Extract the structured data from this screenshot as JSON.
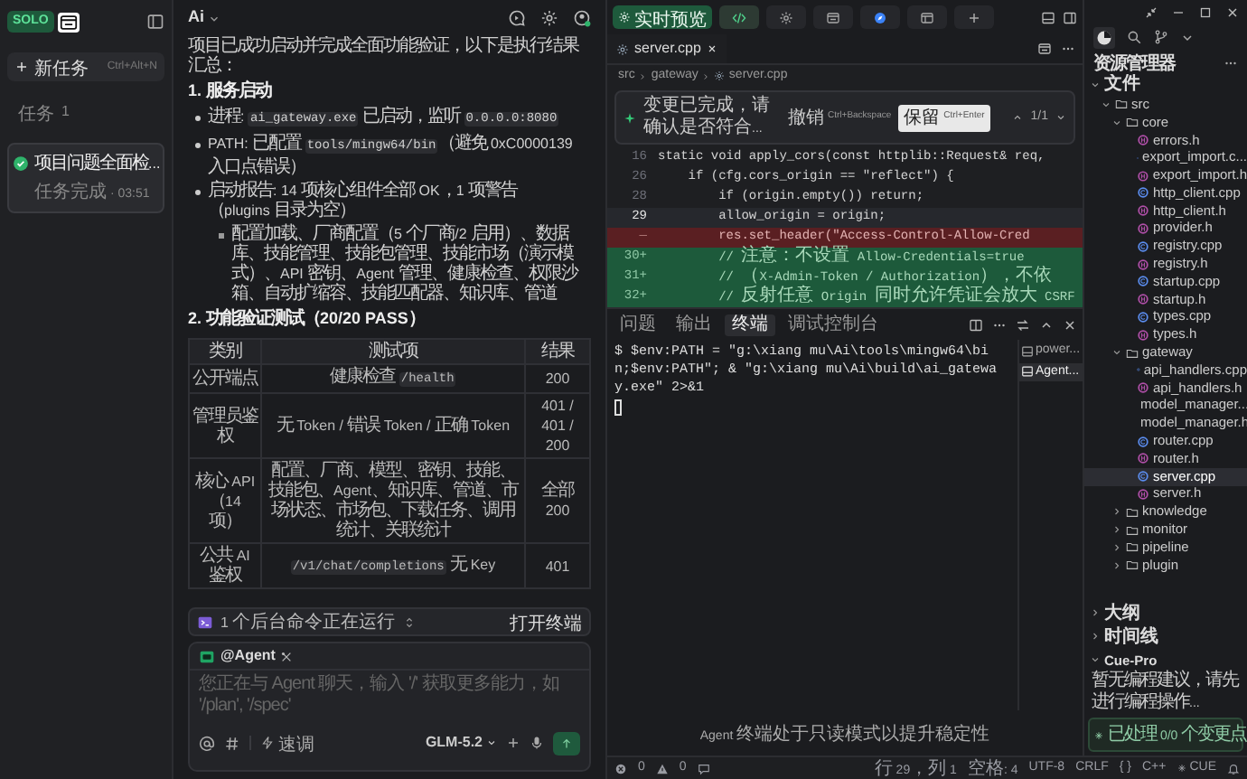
{
  "sidebar": {
    "logo": "SOLO",
    "new_task": {
      "label": "新任务",
      "shortcut": "Ctrl+Alt+N"
    },
    "section": {
      "label": "任务",
      "count": "1"
    },
    "tasks": [
      {
        "title": "项目问题全面检...",
        "status": "任务完成 · 03:51",
        "done": true,
        "selected": true
      }
    ]
  },
  "chat": {
    "title": "Ai",
    "blocks": [
      {
        "kind": "paragraph",
        "segments": [
          {
            "kind": "text",
            "text": "项目已成功启动并完成全面功能验证，以下是执行结果汇总："
          }
        ]
      },
      {
        "kind": "heading",
        "segments": [
          {
            "kind": "text",
            "text": "1. 服务启动"
          }
        ]
      },
      {
        "kind": "bullet",
        "segments": [
          {
            "kind": "text",
            "text": "进程: "
          },
          {
            "kind": "code",
            "text": "ai_gateway.exe"
          },
          {
            "kind": "text",
            "text": " 已启动，监听 "
          },
          {
            "kind": "code",
            "text": "0.0.0.0:8080"
          }
        ]
      },
      {
        "kind": "bullet",
        "segments": [
          {
            "kind": "text",
            "text": "PATH: 已配置 "
          },
          {
            "kind": "code",
            "text": "tools/mingw64/bin"
          },
          {
            "kind": "text",
            "text": "（避免 0xC0000139 入口点错误）"
          }
        ]
      },
      {
        "kind": "bullet",
        "segments": [
          {
            "kind": "text",
            "text": "启动报告: 14 项核心组件全部 OK，1 项警告（plugins 目录为空）"
          }
        ],
        "children": [
          {
            "segments": [
              {
                "kind": "text",
                "text": "配置加载、厂商配置（5 个厂商/2 启用）、数据库、技能管理、技能包管理、技能市场（演示模式）、API 密钥、Agent 管理、健康检查、权限沙箱、自动扩缩容、技能匹配器、知识库、管道"
              }
            ]
          }
        ]
      },
      {
        "kind": "heading",
        "segments": [
          {
            "kind": "text",
            "text": "2. 功能验证测试（20/20 PASS）"
          }
        ]
      },
      {
        "kind": "table",
        "columns": [
          "类别",
          "测试项",
          "结果"
        ],
        "rows": [
          [
            "公开端点",
            [
              {
                "kind": "text",
                "text": "健康检查 "
              },
              {
                "kind": "code",
                "text": "/health"
              }
            ],
            "200"
          ],
          [
            "管理员鉴权",
            "无 Token / 错误 Token / 正确 Token",
            "401 / 401 / 200"
          ],
          [
            "核心 API（14 项）",
            "配置、厂商、模型、密钥、技能、技能包、Agent、知识库、管道、市场状态、市场包、下载任务、调用统计、关联统计",
            "全部 200"
          ],
          [
            "公共 AI 鉴权",
            [
              {
                "kind": "code",
                "text": "/v1/chat/completions"
              },
              {
                "kind": "text",
                "text": " 无 Key"
              }
            ],
            "401"
          ]
        ]
      }
    ],
    "background": {
      "label": "1 个后台命令正在运行",
      "action": "打开终端"
    },
    "composer": {
      "mention": "@Agent",
      "placeholder": "您正在与 Agent 聊天，输入 '/' 获取更多能力，如 '/plan', '/spec'",
      "mode": "速调",
      "model": "GLM-5.2"
    }
  },
  "toolbar": {
    "preview": "实时预览",
    "tabs": [
      {
        "kind": "code",
        "selected": true
      },
      {
        "kind": "gear",
        "selected": false
      },
      {
        "kind": "browser",
        "selected": false
      },
      {
        "kind": "compass",
        "selected": false
      },
      {
        "kind": "window",
        "selected": false
      },
      {
        "kind": "plus",
        "selected": false
      }
    ]
  },
  "editor": {
    "file_tab": "server.cpp",
    "breadcrumb": [
      "src",
      "gateway",
      "server.cpp"
    ],
    "diff_banner": {
      "message": "变更已完成，请确认是否符合...",
      "undo": {
        "label": "撤销",
        "shortcut": "Ctrl+Backspace"
      },
      "keep": {
        "label": "保留",
        "shortcut": "Ctrl+Enter"
      },
      "counter": "1/1"
    },
    "lines": [
      {
        "number": "16",
        "kind": "normal",
        "text": "static void apply_cors(const httplib::Request& req,"
      },
      {
        "number": "26",
        "kind": "normal",
        "text": "    if (cfg.cors_origin == \"reflect\") {"
      },
      {
        "number": "28",
        "kind": "normal",
        "text": "        if (origin.empty()) return;"
      },
      {
        "number": "29",
        "kind": "current",
        "text": "        allow_origin = origin;"
      },
      {
        "number": "—",
        "kind": "removed",
        "text": "        res.set_header(\"Access-Control-Allow-Cred"
      },
      {
        "number": "30+",
        "kind": "added",
        "text": "        // 注意：不设置 Allow-Credentials=true"
      },
      {
        "number": "31+",
        "kind": "added",
        "text": "        // （X-Admin-Token / Authorization），不依"
      },
      {
        "number": "32+",
        "kind": "added",
        "text": "        // 反射任意 Origin 同时允许凭证会放大 CSRF"
      }
    ]
  },
  "terminal": {
    "tabs": [
      {
        "label": "问题",
        "selected": false
      },
      {
        "label": "输出",
        "selected": false
      },
      {
        "label": "终端",
        "selected": true
      },
      {
        "label": "调试控制台",
        "selected": false
      }
    ],
    "prompt": "$",
    "command": "$env:PATH = \"g:\\xiang mu\\Ai\\tools\\mingw64\\bin;$env:PATH\"; & \"g:\\xiang mu\\Ai\\build\\ai_gateway.exe\" 2>&1",
    "sessions": [
      {
        "label": "power...",
        "selected": false
      },
      {
        "label": "Agent...",
        "selected": true
      }
    ],
    "notice": "Agent 终端处于只读模式以提升稳定性"
  },
  "explorer": {
    "title": "资源管理器",
    "tree": [
      {
        "label": "文件",
        "kind": "section",
        "expanded": true,
        "children": [
          {
            "label": "src",
            "kind": "folder",
            "expanded": true,
            "children": [
              {
                "label": "core",
                "kind": "folder",
                "expanded": true,
                "children": [
                  {
                    "label": "errors.h",
                    "kind": "h",
                    "selected": false
                  },
                  {
                    "label": "export_import.c...",
                    "kind": "cpp",
                    "selected": false
                  },
                  {
                    "label": "export_import.h",
                    "kind": "h",
                    "selected": false
                  },
                  {
                    "label": "http_client.cpp",
                    "kind": "cpp",
                    "selected": false
                  },
                  {
                    "label": "http_client.h",
                    "kind": "h",
                    "selected": false
                  },
                  {
                    "label": "provider.h",
                    "kind": "h",
                    "selected": false
                  },
                  {
                    "label": "registry.cpp",
                    "kind": "cpp",
                    "selected": false
                  },
                  {
                    "label": "registry.h",
                    "kind": "h",
                    "selected": false
                  },
                  {
                    "label": "startup.cpp",
                    "kind": "cpp",
                    "selected": false
                  },
                  {
                    "label": "startup.h",
                    "kind": "h",
                    "selected": false
                  },
                  {
                    "label": "types.cpp",
                    "kind": "cpp",
                    "selected": false
                  },
                  {
                    "label": "types.h",
                    "kind": "h",
                    "selected": false
                  }
                ]
              },
              {
                "label": "gateway",
                "kind": "folder",
                "expanded": true,
                "children": [
                  {
                    "label": "api_handlers.cpp",
                    "kind": "cpp",
                    "selected": false
                  },
                  {
                    "label": "api_handlers.h",
                    "kind": "h",
                    "selected": false
                  },
                  {
                    "label": "model_manager...",
                    "kind": "cpp",
                    "selected": false
                  },
                  {
                    "label": "model_manager.h",
                    "kind": "h",
                    "selected": false
                  },
                  {
                    "label": "router.cpp",
                    "kind": "cpp",
                    "selected": false
                  },
                  {
                    "label": "router.h",
                    "kind": "h",
                    "selected": false
                  },
                  {
                    "label": "server.cpp",
                    "kind": "cpp",
                    "selected": true
                  },
                  {
                    "label": "server.h",
                    "kind": "h",
                    "selected": false
                  }
                ]
              },
              {
                "label": "knowledge",
                "kind": "folder",
                "expanded": false
              },
              {
                "label": "monitor",
                "kind": "folder",
                "expanded": false
              },
              {
                "label": "pipeline",
                "kind": "folder",
                "expanded": false
              },
              {
                "label": "plugin",
                "kind": "folder",
                "expanded": false
              }
            ]
          }
        ]
      }
    ],
    "panels": [
      {
        "label": "大纲",
        "expanded": false
      },
      {
        "label": "时间线",
        "expanded": false
      },
      {
        "label": "Cue-Pro",
        "expanded": true,
        "message": "暂无编程建议，请先进行编程操作...",
        "status": "已处理 0/0 个变更点"
      }
    ]
  },
  "status_bar": {
    "errors": "0",
    "warnings": "0",
    "position": "行 29，列 1",
    "indent": "空格: 4",
    "encoding": "UTF-8",
    "eol": "CRLF",
    "braces": "{ }",
    "language": "C++",
    "cue": "CUE"
  }
}
